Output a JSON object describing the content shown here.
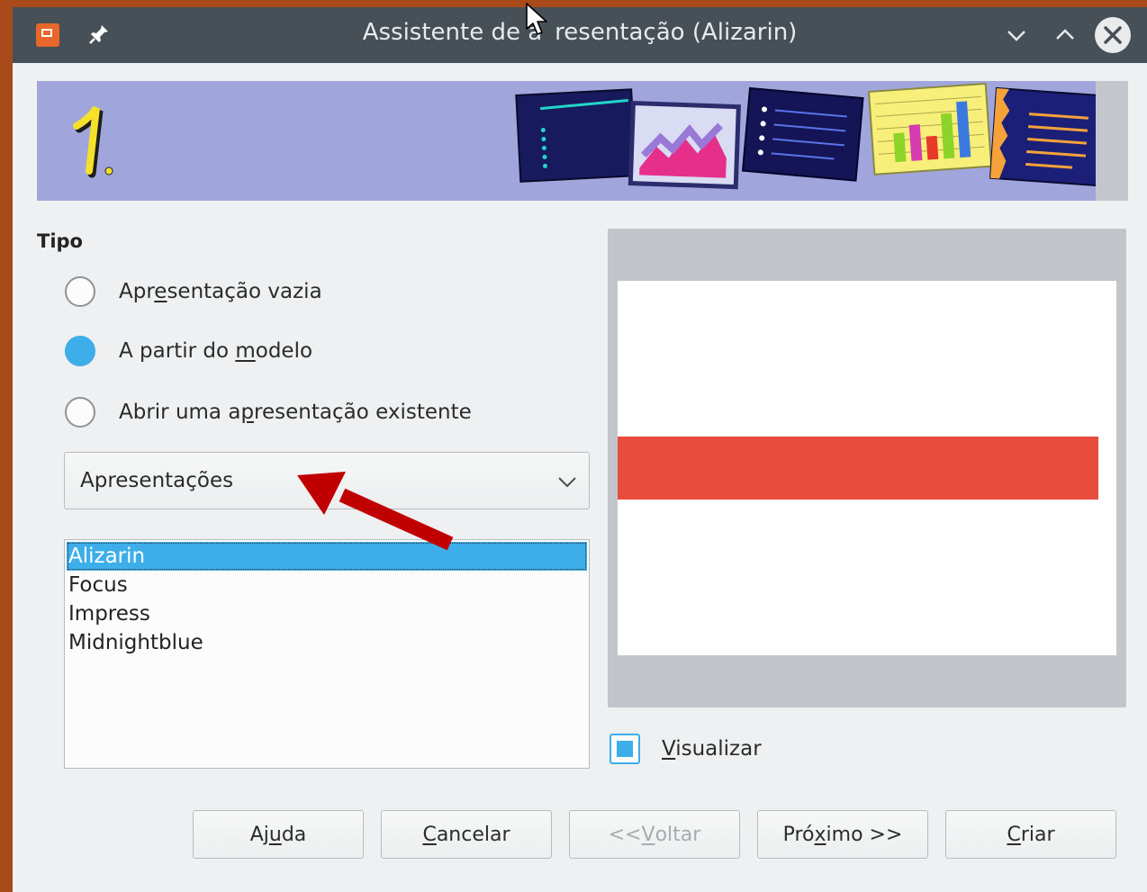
{
  "window": {
    "title": "Assistente de apresentação (Alizarin)",
    "title_visible_prefix": "Assistente de a",
    "title_visible_suffix": "resentação (Alizarin)",
    "icons": [
      "presentation-app-icon",
      "pin-icon",
      "chevron-down-icon",
      "chevron-up-icon",
      "close-icon"
    ]
  },
  "banner": {
    "step_number": "1."
  },
  "type_section": {
    "label": "Tipo",
    "options": [
      {
        "parts": [
          "Apr",
          "e",
          "sentação vazia"
        ],
        "checked": false
      },
      {
        "parts": [
          "A partir do ",
          "m",
          "odelo"
        ],
        "checked": true
      },
      {
        "parts": [
          "Abrir uma a",
          "p",
          "resentação existente"
        ],
        "checked": false
      }
    ]
  },
  "category_combo": {
    "selected": "Apresentações"
  },
  "template_list": {
    "items": [
      "Alizarin",
      "Focus",
      "Impress",
      "Midnightblue"
    ],
    "selected_index": 0
  },
  "preview": {
    "checkbox_label_parts": [
      "",
      "V",
      "isualizar"
    ],
    "checked": true
  },
  "buttons": [
    {
      "parts": [
        "Aj",
        "u",
        "da"
      ],
      "enabled": true
    },
    {
      "parts": [
        "",
        "C",
        "ancelar"
      ],
      "enabled": true
    },
    {
      "parts": [
        "<<",
        "V",
        "oltar"
      ],
      "enabled": false
    },
    {
      "parts": [
        "Pró",
        "x",
        "imo >>"
      ],
      "enabled": true
    },
    {
      "parts": [
        "",
        "C",
        "riar"
      ],
      "enabled": true
    }
  ],
  "colors": {
    "accent": "#3daee9",
    "titlebar": "#475057",
    "preview_bar": "#e74c3c",
    "annotation_arrow": "#c00000"
  }
}
